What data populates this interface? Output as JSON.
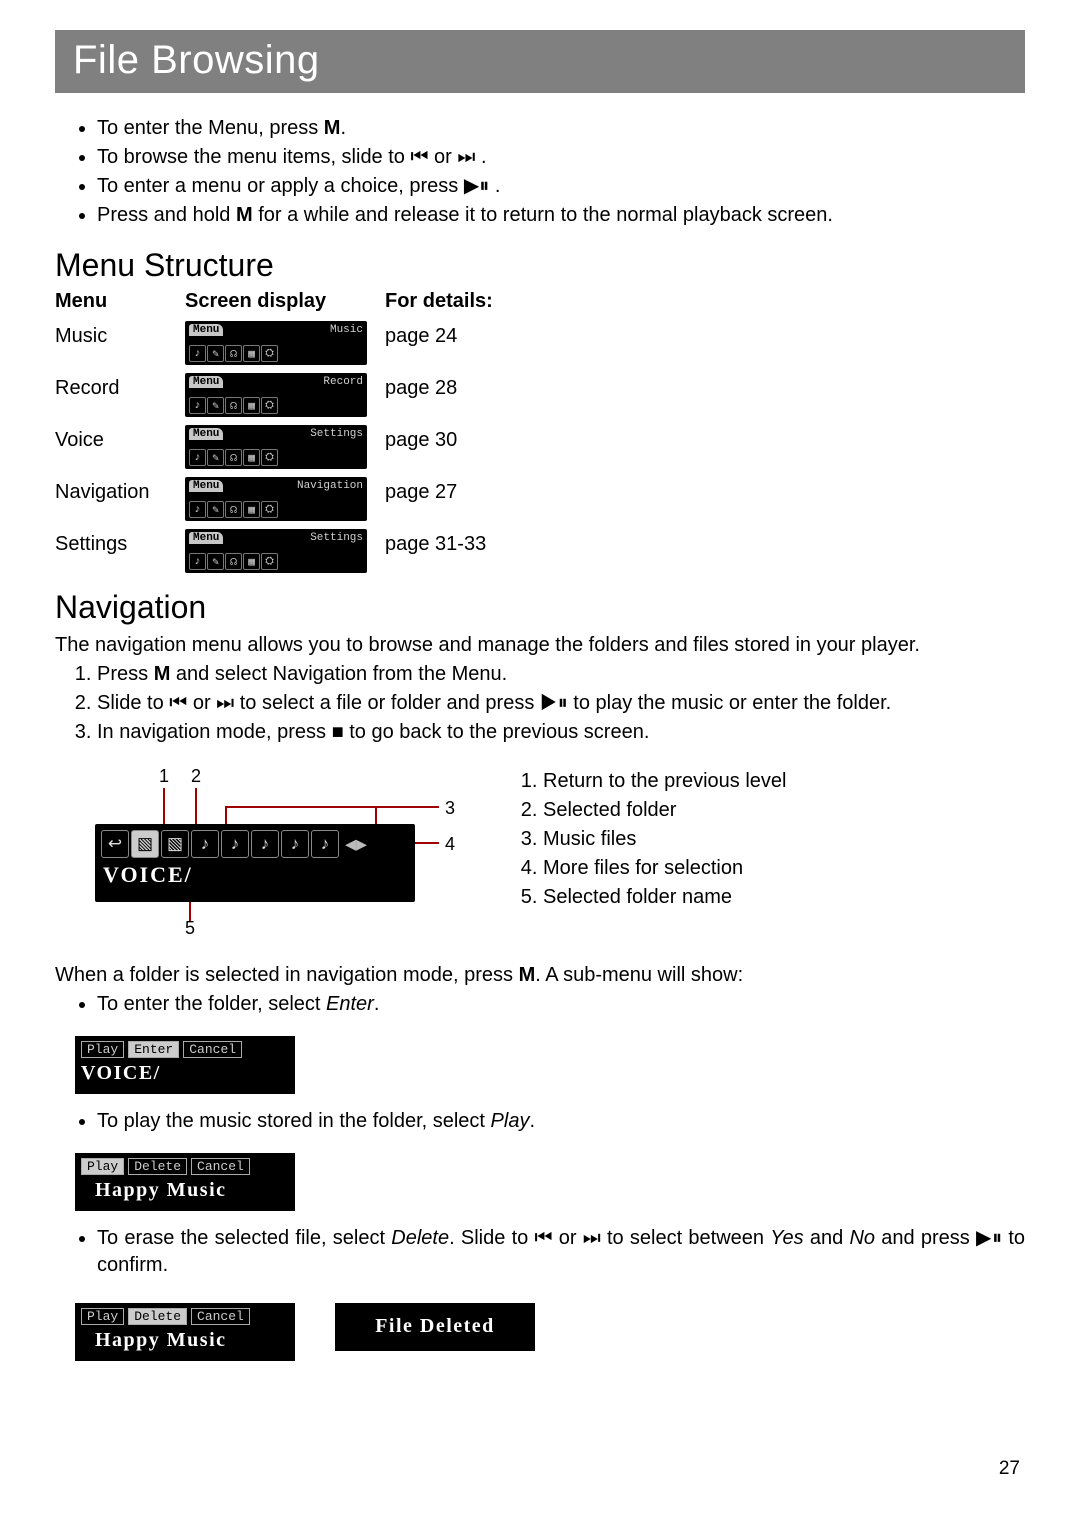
{
  "title": "File Browsing",
  "intro_bullets": [
    {
      "pre": "To enter the Menu, press ",
      "bold": "M",
      "post": "."
    },
    {
      "pre": "To browse the menu items, slide to ",
      "sym": "⏮ or ⏭",
      "post": " ."
    },
    {
      "pre": "To enter a menu or apply a choice, press ",
      "sym": "▶⏸",
      "post": " ."
    },
    {
      "pre": "Press and hold ",
      "bold": "M",
      "post": " for a while and release it to return to the normal playback screen."
    }
  ],
  "menu_structure": {
    "heading": "Menu Structure",
    "head_cols": [
      "Menu",
      "Screen display",
      "For details:"
    ],
    "rows": [
      {
        "menu": "Music",
        "label": "Music",
        "details": "page 24"
      },
      {
        "menu": "Record",
        "label": "Record",
        "details": "page 28"
      },
      {
        "menu": "Voice",
        "label": "Settings",
        "details": "page 30"
      },
      {
        "menu": "Navigation",
        "label": "Navigation",
        "details": "page 27"
      },
      {
        "menu": "Settings",
        "label": "Settings",
        "details": "page 31-33"
      }
    ],
    "lcd_tab": "Menu",
    "lcd_icons": [
      "♪",
      "✎",
      "☊",
      "▦",
      "⛭"
    ]
  },
  "navigation": {
    "heading": "Navigation",
    "intro": "The navigation menu allows you to browse and manage the folders and files stored in your player.",
    "steps_raw": {
      "s1": {
        "pre": "Press ",
        "bold": "M",
        "post": " and select Navigation from the Menu."
      },
      "s2": "Slide to ⏮ or ⏭  to select a file or folder and press ▶⏸ to play the music or enter the folder.",
      "s3": "In navigation mode, press ■  to go back to the previous screen."
    },
    "diagram": {
      "callouts": [
        "1",
        "2",
        "3",
        "4",
        "5"
      ],
      "voice_label": "VOICE/",
      "legend": [
        "Return to the previous level",
        "Selected folder",
        "Music files",
        "More files for selection",
        "Selected folder name"
      ]
    },
    "submenu_intro": {
      "pre": "When a folder is selected in navigation mode, press ",
      "bold": "M",
      "post": ". A sub-menu will show:"
    },
    "sub_bullets": {
      "enter": {
        "pre": "To enter the folder, select ",
        "ital": "Enter",
        "post": "."
      },
      "play": {
        "pre": "To play the music stored in the folder, select ",
        "ital": "Play",
        "post": "."
      },
      "delete": {
        "pre": "To erase the selected file, select ",
        "ital": "Delete",
        "mid": ". Slide to ⏮ or ⏭  to select between ",
        "ital2": "Yes",
        "mid2": " and ",
        "ital3": "No",
        "post": " and press ▶⏸ to confirm."
      }
    },
    "lcd_enter": {
      "opts": [
        "Play",
        "Enter",
        "Cancel"
      ],
      "sel": "Enter",
      "title": "VOICE/"
    },
    "lcd_play": {
      "opts": [
        "Play",
        "Delete",
        "Cancel"
      ],
      "sel": "Play",
      "title": "Happy Music"
    },
    "lcd_del": {
      "opts": [
        "Play",
        "Delete",
        "Cancel"
      ],
      "sel": "Delete",
      "title": "Happy Music"
    },
    "lcd_deleted_msg": "File Deleted"
  },
  "page_number": "27"
}
